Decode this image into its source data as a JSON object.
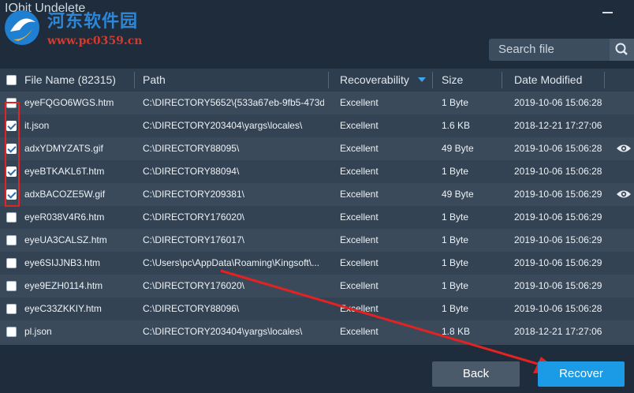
{
  "app": {
    "title": "IObit Undelete"
  },
  "watermark": {
    "name": "河东软件园",
    "url": "www.pc0359.cn"
  },
  "search": {
    "placeholder": "Search file"
  },
  "table": {
    "columns": {
      "file_name": "File Name (82315)",
      "path": "Path",
      "recoverability": "Recoverability",
      "size": "Size",
      "date_modified": "Date Modified"
    },
    "rows": [
      {
        "name": "eyeFQGO6WGS.htm",
        "path": "C:\\DIRECTORY5652\\{533a67eb-9fb5-473d...",
        "recoverability": "Excellent",
        "size": "1 Byte",
        "date": "2019-10-06 15:06:28",
        "checked": false,
        "preview": false
      },
      {
        "name": "it.json",
        "path": "C:\\DIRECTORY203404\\yargs\\locales\\",
        "recoverability": "Excellent",
        "size": "1.6 KB",
        "date": "2018-12-21 17:27:06",
        "checked": true,
        "preview": false
      },
      {
        "name": "adxYDMYZATS.gif",
        "path": "C:\\DIRECTORY88095\\",
        "recoverability": "Excellent",
        "size": "49 Byte",
        "date": "2019-10-06 15:06:28",
        "checked": true,
        "preview": true
      },
      {
        "name": "eyeBTKAKL6T.htm",
        "path": "C:\\DIRECTORY88094\\",
        "recoverability": "Excellent",
        "size": "1 Byte",
        "date": "2019-10-06 15:06:28",
        "checked": true,
        "preview": false
      },
      {
        "name": "adxBACOZE5W.gif",
        "path": "C:\\DIRECTORY209381\\",
        "recoverability": "Excellent",
        "size": "49 Byte",
        "date": "2019-10-06 15:06:29",
        "checked": true,
        "preview": true
      },
      {
        "name": "eyeR038V4R6.htm",
        "path": "C:\\DIRECTORY176020\\",
        "recoverability": "Excellent",
        "size": "1 Byte",
        "date": "2019-10-06 15:06:29",
        "checked": false,
        "preview": false
      },
      {
        "name": "eyeUA3CALSZ.htm",
        "path": "C:\\DIRECTORY176017\\",
        "recoverability": "Excellent",
        "size": "1 Byte",
        "date": "2019-10-06 15:06:29",
        "checked": false,
        "preview": false
      },
      {
        "name": "eye6SIJJNB3.htm",
        "path": "C:\\Users\\pc\\AppData\\Roaming\\Kingsoft\\...",
        "recoverability": "Excellent",
        "size": "1 Byte",
        "date": "2019-10-06 15:06:29",
        "checked": false,
        "preview": false
      },
      {
        "name": "eye9EZH0114.htm",
        "path": "C:\\DIRECTORY176020\\",
        "recoverability": "Excellent",
        "size": "1 Byte",
        "date": "2019-10-06 15:06:29",
        "checked": false,
        "preview": false
      },
      {
        "name": "eyeC33ZKKIY.htm",
        "path": "C:\\DIRECTORY88096\\",
        "recoverability": "Excellent",
        "size": "1 Byte",
        "date": "2019-10-06 15:06:28",
        "checked": false,
        "preview": false
      },
      {
        "name": "pl.json",
        "path": "C:\\DIRECTORY203404\\yargs\\locales\\",
        "recoverability": "Excellent",
        "size": "1.8 KB",
        "date": "2018-12-21 17:27:06",
        "checked": false,
        "preview": false
      }
    ]
  },
  "buttons": {
    "back": "Back",
    "recover": "Recover"
  },
  "colors": {
    "accent": "#1b9ae6",
    "annotation": "#e32222",
    "background": "#1e2c3b"
  },
  "icons": {
    "search": "search-icon",
    "preview": "eye-icon",
    "minimize": "minimize-icon",
    "sort": "sort-desc-icon"
  }
}
